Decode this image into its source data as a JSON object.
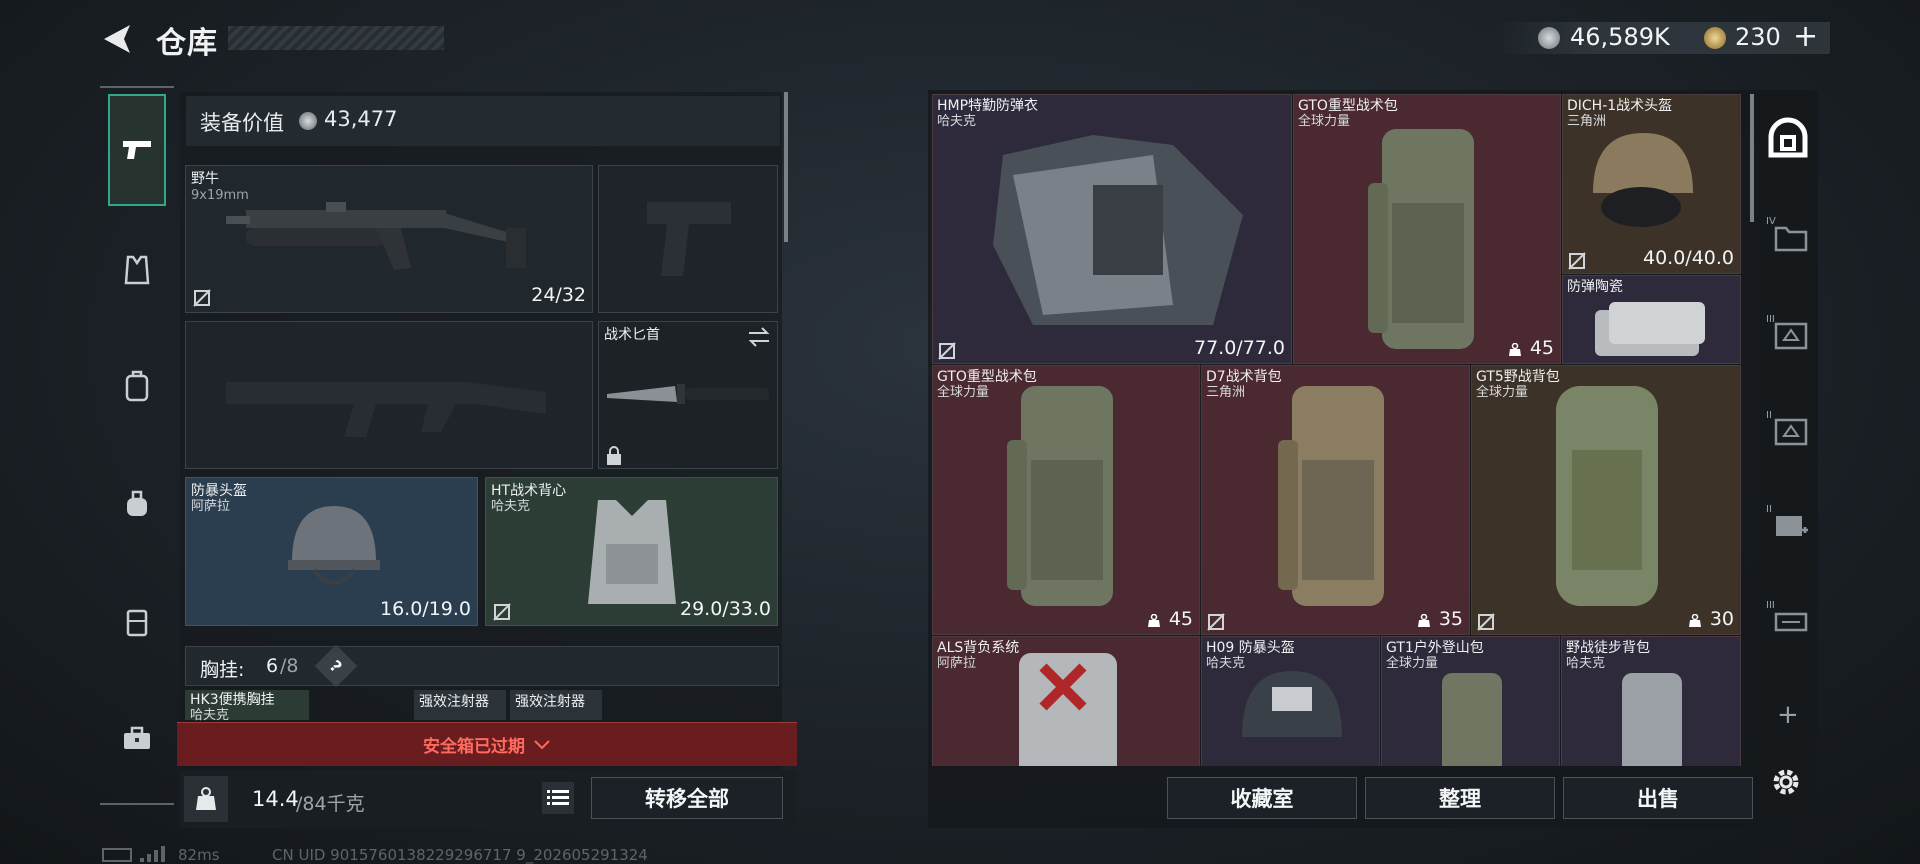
{
  "header": {
    "title": "仓库"
  },
  "currency": {
    "coins": "46,589K",
    "premium": "230",
    "plus": "+"
  },
  "equipment": {
    "value_label": "装备价值",
    "value": "43,477"
  },
  "slots": {
    "primary": {
      "name": "野牛",
      "caliber": "9x19mm",
      "ammo": "24/32"
    },
    "knife": {
      "name": "战术匕首"
    },
    "helmet": {
      "name": "防暴头盔",
      "origin": "阿萨拉",
      "durability": "16.0/19.0"
    },
    "armor": {
      "name": "HT战术背心",
      "origin": "哈夫克",
      "durability": "29.0/33.0"
    }
  },
  "chest_rig": {
    "label": "胸挂:",
    "count": "6",
    "total": "/8",
    "help": "?"
  },
  "rig_items": [
    {
      "name": "HK3便携胸挂",
      "origin": "哈夫克"
    },
    {
      "name": "强效注射器"
    },
    {
      "name": "强效注射器"
    }
  ],
  "safe_box": {
    "text": "安全箱已过期"
  },
  "weight": {
    "current": "14.4",
    "max": "/84千克"
  },
  "transfer_all": "转移全部",
  "stash_items": [
    {
      "name": "HMP特勤防弹衣",
      "origin": "哈夫克",
      "durability": "77.0/77.0"
    },
    {
      "name": "GTO重型战术包",
      "origin": "全球力量",
      "count": "45"
    },
    {
      "name": "DICH-1战术头盔",
      "origin": "三角洲",
      "durability": "40.0/40.0"
    },
    {
      "name": "防弹陶瓷"
    },
    {
      "name": "GTO重型战术包",
      "origin": "全球力量",
      "count": "45"
    },
    {
      "name": "D7战术背包",
      "origin": "三角洲",
      "count": "35"
    },
    {
      "name": "GT5野战背包",
      "origin": "全球力量",
      "count": "30"
    },
    {
      "name": "ALS背负系统",
      "origin": "阿萨拉"
    },
    {
      "name": "H09 防暴头盔",
      "origin": "哈夫克"
    },
    {
      "name": "GT1户外登山包",
      "origin": "全球力量"
    },
    {
      "name": "野战徒步背包",
      "origin": "哈夫克"
    }
  ],
  "stash_tabs": [
    "IV",
    "III",
    "II",
    "II",
    "III"
  ],
  "stash_tab_plus": "+",
  "bottom_buttons": {
    "collection": "收藏室",
    "sort": "整理",
    "sell": "出售"
  },
  "status": {
    "ping": "82ms",
    "uid": "CN UID 9015760138229296717 9_202605291324"
  },
  "colors": {
    "item_red": "#4a2a30",
    "item_purple": "#2e2a3b",
    "item_gold": "#3d3228",
    "item_blue": "#2b3e4f",
    "item_green": "#2b3d35",
    "alert_red": "#6a1d1f"
  }
}
